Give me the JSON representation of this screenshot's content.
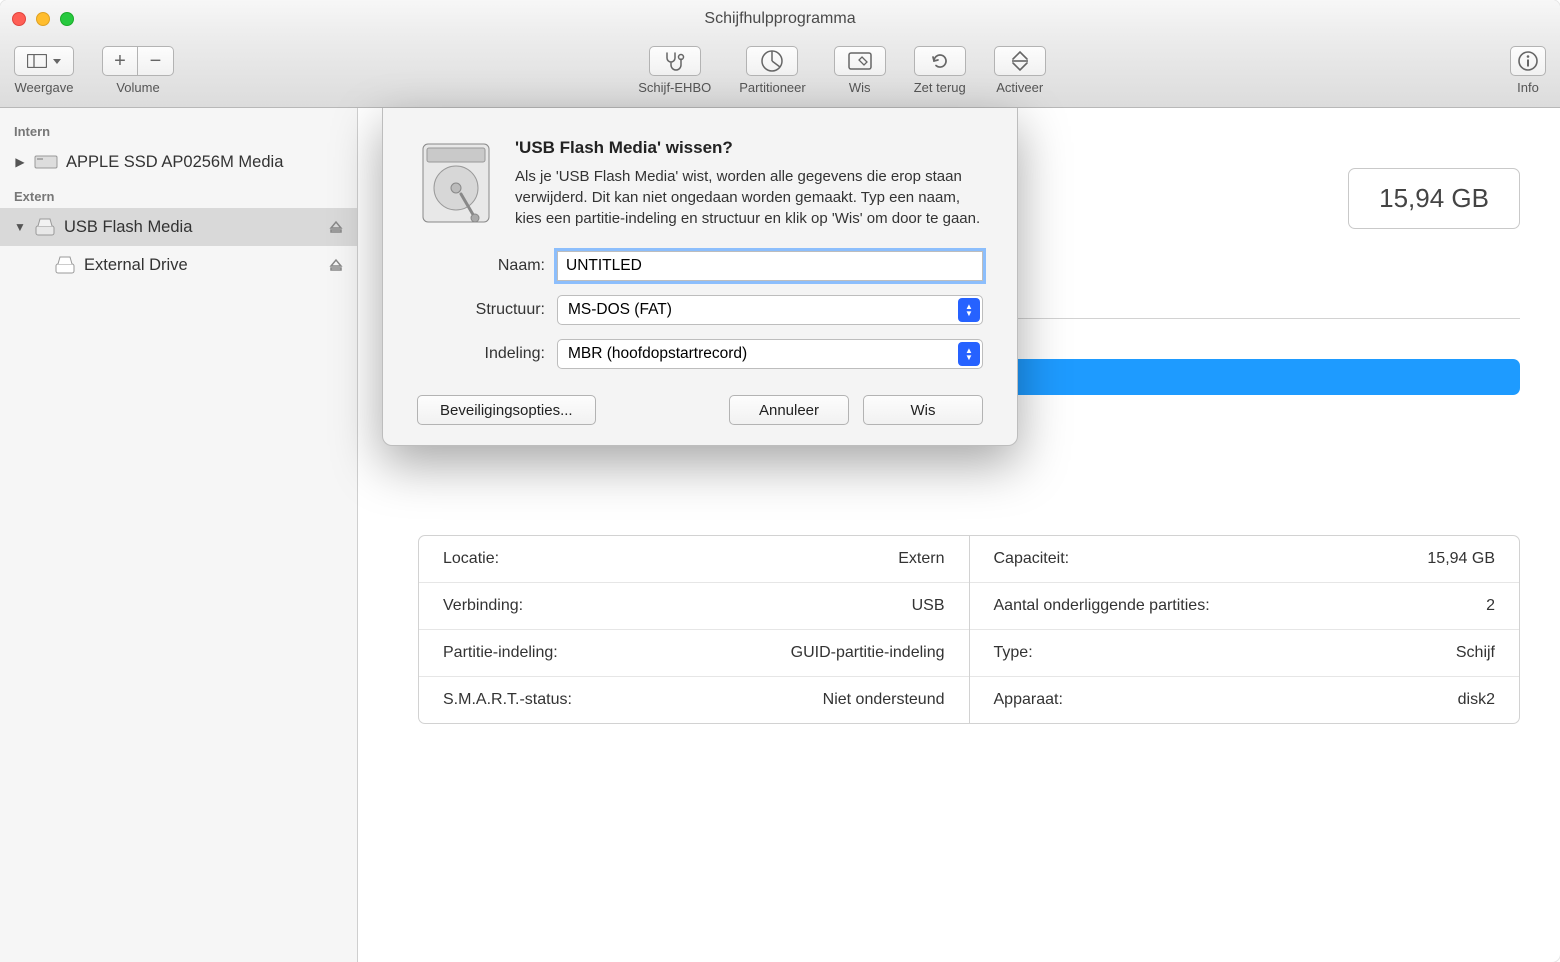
{
  "window": {
    "title": "Schijfhulpprogramma"
  },
  "toolbar": {
    "view_label": "Weergave",
    "volume_label": "Volume",
    "firstaid_label": "Schijf-EHBO",
    "partition_label": "Partitioneer",
    "erase_label": "Wis",
    "restore_label": "Zet terug",
    "mount_label": "Activeer",
    "info_label": "Info"
  },
  "sidebar": {
    "internal_header": "Intern",
    "external_header": "Extern",
    "internal_disk": "APPLE SSD AP0256M Media",
    "external_disk": "USB Flash Media",
    "external_volume": "External Drive"
  },
  "main": {
    "size_badge": "15,94 GB",
    "info_left": [
      {
        "k": "Locatie:",
        "v": "Extern"
      },
      {
        "k": "Verbinding:",
        "v": "USB"
      },
      {
        "k": "Partitie-indeling:",
        "v": "GUID-partitie-indeling"
      },
      {
        "k": "S.M.A.R.T.-status:",
        "v": "Niet ondersteund"
      }
    ],
    "info_right": [
      {
        "k": "Capaciteit:",
        "v": "15,94 GB"
      },
      {
        "k": "Aantal onderliggende partities:",
        "v": "2"
      },
      {
        "k": "Type:",
        "v": "Schijf"
      },
      {
        "k": "Apparaat:",
        "v": "disk2"
      }
    ]
  },
  "sheet": {
    "title": "'USB Flash Media' wissen?",
    "text": "Als je 'USB Flash Media' wist, worden alle gegevens die erop staan verwijderd. Dit kan niet ongedaan worden gemaakt. Typ een naam, kies een partitie-indeling en structuur en klik op 'Wis' om door te gaan.",
    "name_label": "Naam:",
    "name_value": "UNTITLED",
    "format_label": "Structuur:",
    "format_value": "MS-DOS (FAT)",
    "scheme_label": "Indeling:",
    "scheme_value": "MBR (hoofdopstartrecord)",
    "security_btn": "Beveiligingsopties...",
    "cancel_btn": "Annuleer",
    "erase_btn": "Wis"
  }
}
